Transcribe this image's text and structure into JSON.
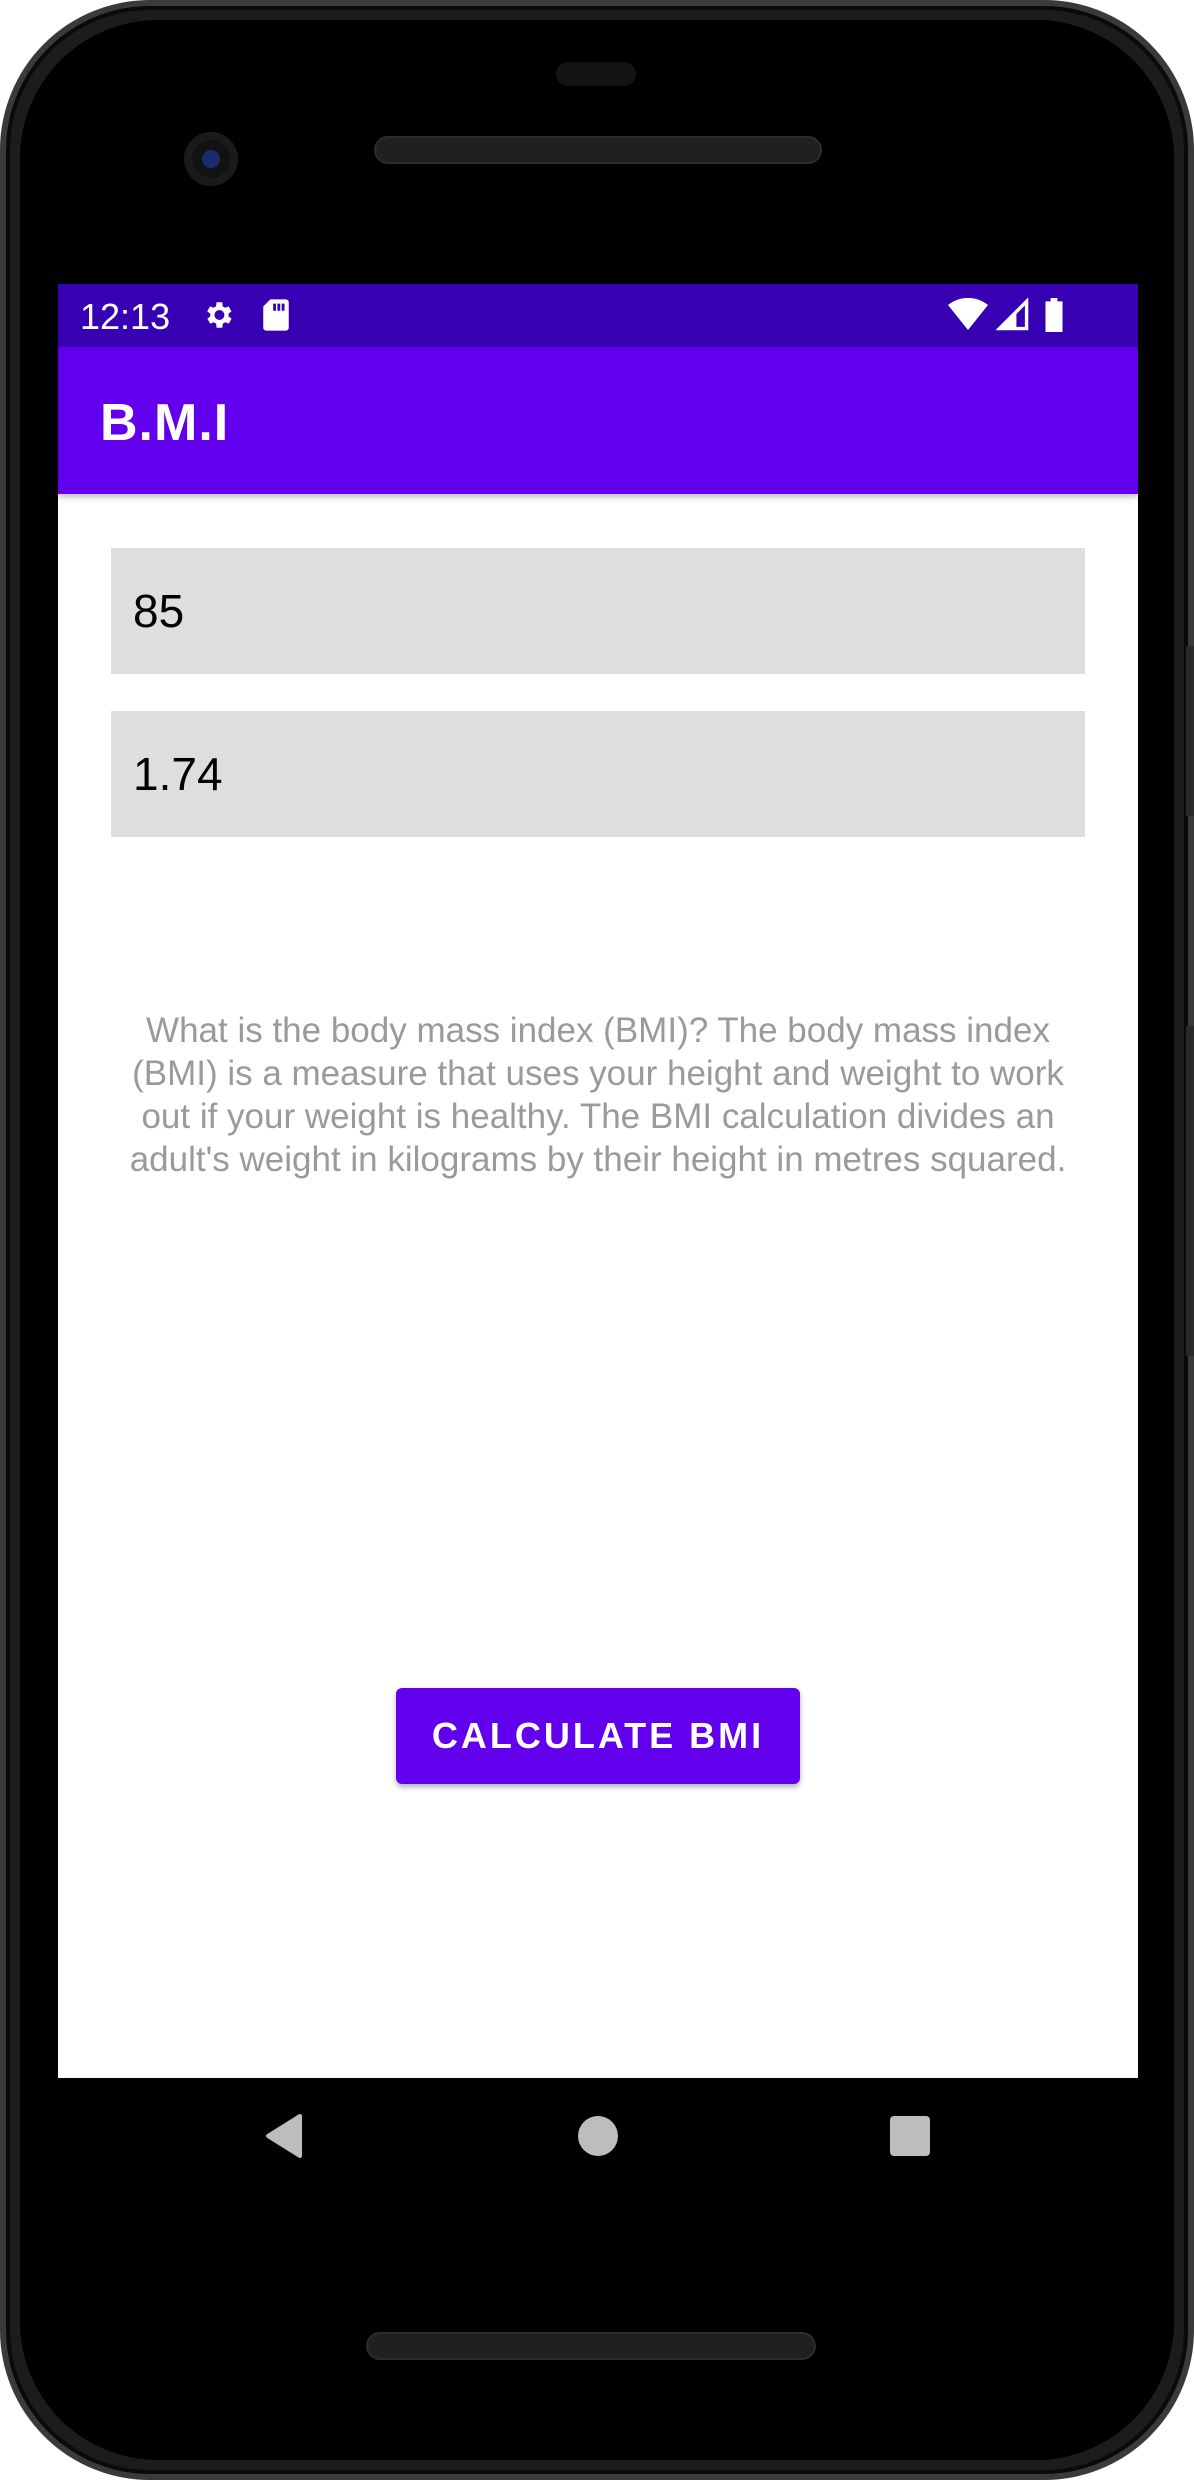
{
  "status_bar": {
    "time": "12:13",
    "icons": [
      "gear-icon",
      "sd-card-icon",
      "wifi-icon",
      "cell-signal-icon",
      "battery-icon"
    ]
  },
  "app_bar": {
    "title": "B.M.I"
  },
  "form": {
    "weight_value": "85",
    "height_value": "1.74"
  },
  "description": "What is the body mass index (BMI)? The body mass index (BMI) is a measure that uses your height and weight to work out if your weight is healthy.  The BMI calculation divides an adult's weight in kilograms by their height in metres squared.",
  "button": {
    "calculate_label": "CALCULATE BMI"
  },
  "nav_bar": {
    "icons": [
      "back-icon",
      "home-icon",
      "recents-icon"
    ]
  },
  "colors": {
    "primary": "#6200ee",
    "primary_dark": "#3700b3",
    "field_bg": "#dedede",
    "description_text": "#9a9a9a"
  }
}
